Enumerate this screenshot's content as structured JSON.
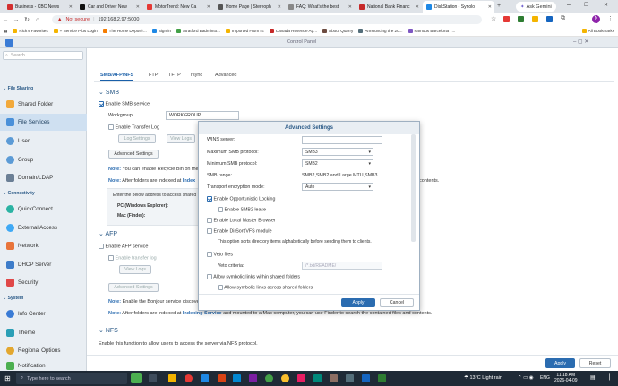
{
  "browser": {
    "tabs": [
      "Business - CBC News",
      "Car and Driver New",
      "MotorTrend: New Ca",
      "Home Page | Stereoph",
      "FAQ: What's the best",
      "National Bank Financ",
      "DiskStation - Synolo"
    ],
    "ask_gemini": "Ask Gemini",
    "url_security": "Not secure",
    "url": "192.168.2.97:5000",
    "bookmarks": [
      "Rick's Favorites",
      "+ Service Plus Login",
      "The Home Depot®...",
      "Sign in",
      "Stratford Badminto...",
      "Imported From IE",
      "Canada Revenue Ag...",
      "About Quarry",
      "Announcing the 20...",
      "Famous Barcelona T...",
      "All Bookmarks"
    ]
  },
  "dsm": {
    "window_title": "Control Panel",
    "search_placeholder": "Search"
  },
  "sidebar": {
    "sections": [
      "File Sharing",
      "Connectivity",
      "System"
    ],
    "items": [
      "Shared Folder",
      "File Services",
      "User",
      "Group",
      "Domain/LDAP",
      "QuickConnect",
      "External Access",
      "Network",
      "DHCP Server",
      "Security",
      "Info Center",
      "Theme",
      "Regional Options",
      "Notification"
    ]
  },
  "main": {
    "tabs": [
      "SMB/AFP/NFS",
      "FTP",
      "TFTP",
      "rsync",
      "Advanced"
    ],
    "smb_title": "SMB",
    "enable_smb": "Enable SMB service",
    "workgroup_label": "Workgroup:",
    "workgroup_value": "WORKGROUP",
    "enable_transfer_log": "Enable Transfer Log",
    "log_settings": "Log Settings",
    "view_logs": "View Logs",
    "advanced_settings": "Advanced Settings",
    "note1_prefix": "Note:",
    "note1": "You can enable Recycle Bin on the",
    "note2_prefix": "Note:",
    "note2_a": "After folders are indexed at",
    "note2_link": "Index",
    "note2_b": "contents.",
    "addr_intro": "Enter the below address to access shared",
    "pc_label": "PC (Windows Explorer):",
    "mac_label": "Mac (Finder):",
    "afp_title": "AFP",
    "enable_afp": "Enable AFP service",
    "afp_transfer_log": "Enable transfer log",
    "afp_view_logs": "View Logs",
    "afp_advanced": "Advanced Settings",
    "afp_note1_prefix": "Note:",
    "afp_note1": "Enable the Bonjour service discove",
    "afp_note2_prefix": "Note:",
    "afp_note2_a": "After folders are indexed at",
    "afp_note2_link": "Indexing Service",
    "afp_note2_b": "and mounted to a Mac computer, you can use Finder to search the contained files and contents.",
    "nfs_title": "NFS",
    "nfs_desc": "Enable this function to allow users to access the server via NFS protocol.",
    "apply": "Apply",
    "reset": "Reset"
  },
  "dialog": {
    "title": "Advanced Settings",
    "wins_label": "WINS server:",
    "max_smb_label": "Maximum SMB protocol:",
    "max_smb_value": "SMB3",
    "min_smb_label": "Minimum SMB protocol:",
    "min_smb_value": "SMB2",
    "range_label": "SMB range:",
    "range_value": "SMB2,SMB2 and Large MTU,SMB3",
    "enc_label": "Transport encryption mode:",
    "enc_value": "Auto",
    "opportunistic": "Enable Opportunistic Locking",
    "smb2_lease": "Enable SMB2 lease",
    "local_master": "Enable Local Master Browser",
    "dirsort": "Enable DirSort VFS module",
    "dirsort_desc": "This option sorts directory items alphabetically before sending them to clients.",
    "veto_files": "Veto files",
    "veto_criteria_label": "Veto criteria:",
    "veto_criteria_placeholder": "/*.txt/README/",
    "symlinks": "Allow symbolic links within shared folders",
    "symlinks_across": "Allow symbolic links across shared folders",
    "apply": "Apply",
    "cancel": "Cancel"
  },
  "taskbar": {
    "search_placeholder": "Type here to search",
    "weather": "13°C  Light rain",
    "lang": "ENG",
    "time": "11:18 AM",
    "date": "2026-04-09"
  }
}
